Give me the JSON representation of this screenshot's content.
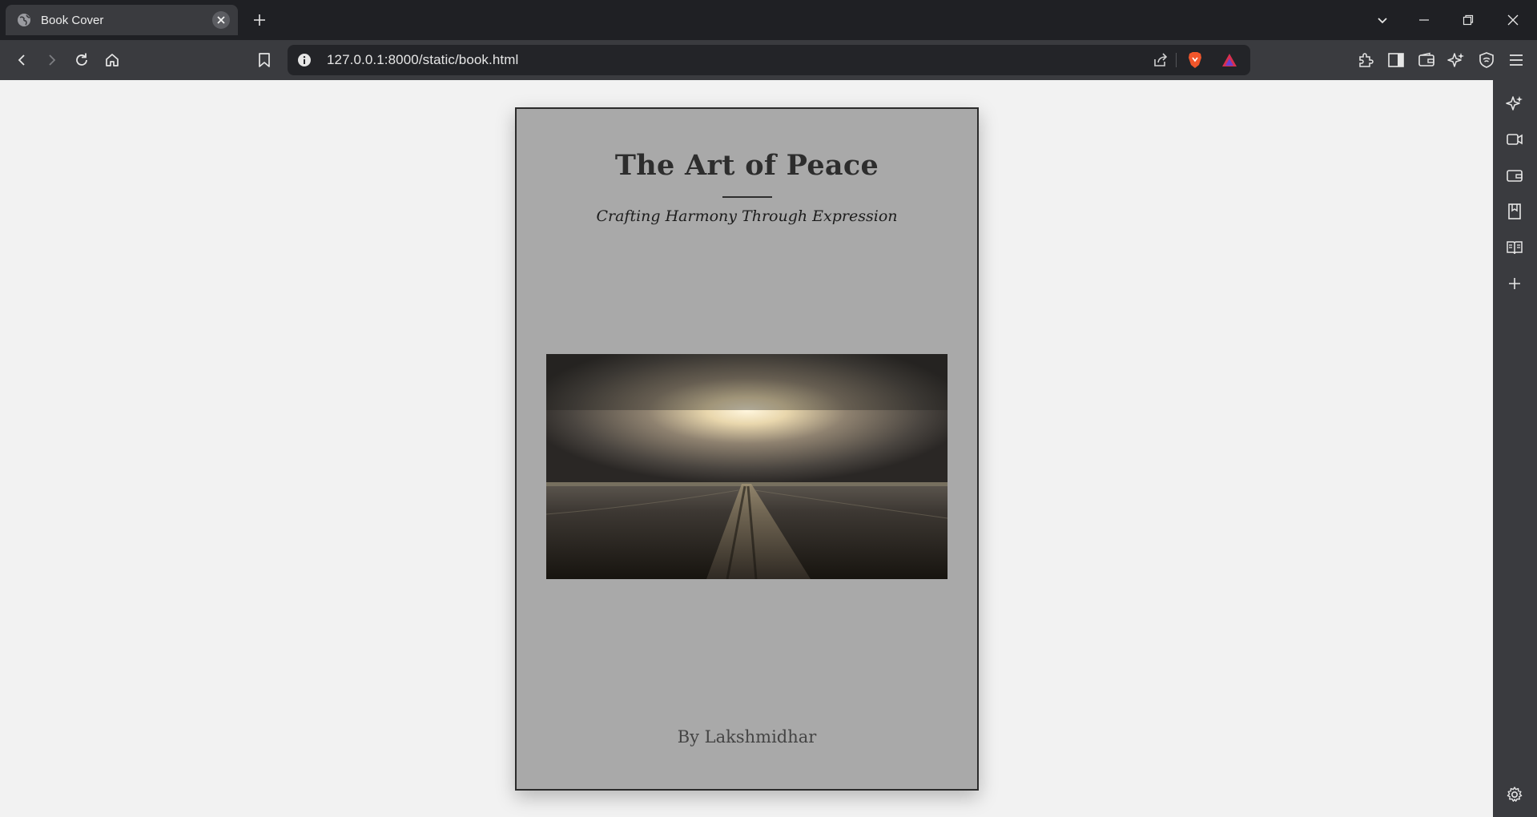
{
  "browser": {
    "tab": {
      "title": "Book Cover",
      "favicon": "globe-icon"
    },
    "address_bar": {
      "url": "127.0.0.1:8000/static/book.html"
    },
    "colors": {
      "tabstrip": "#1f2024",
      "toolbar": "#3a3b3f",
      "urlbar": "#232428"
    }
  },
  "book": {
    "title": "The Art of Peace",
    "subtitle": "Crafting Harmony Through Expression",
    "author": "By Lakshmidhar",
    "cover_color": "#a9a9a9",
    "image_description": "sepia landscape photo of a dirt road leading to a bright horizon under storm clouds"
  }
}
